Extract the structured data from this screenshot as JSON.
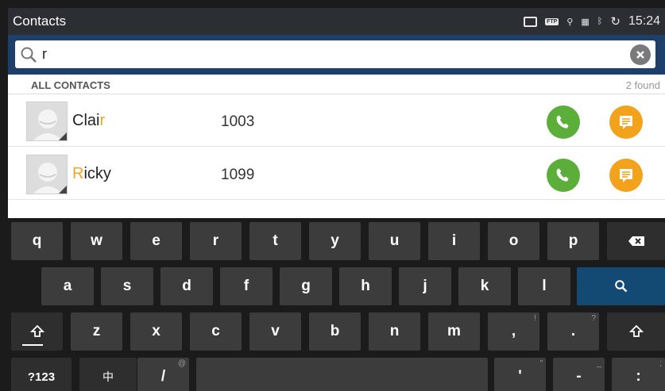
{
  "status_bar": {
    "title": "Contacts",
    "ftp_label": "FTP",
    "time": "15:24"
  },
  "search": {
    "query": "r",
    "placeholder": ""
  },
  "section": {
    "label": "ALL CONTACTS",
    "count": "2 found"
  },
  "contacts": [
    {
      "name_prefix": "Clai",
      "name_highlight": "r",
      "name_suffix": "",
      "number": "1003"
    },
    {
      "name_prefix": "",
      "name_highlight": "R",
      "name_suffix": "icky",
      "number": "1099"
    }
  ],
  "colors": {
    "accent_highlight": "#f0a51e",
    "call_green": "#5cae3a",
    "message_orange": "#f2a31b",
    "search_bar": "#1f3f6b",
    "search_key": "#134a73"
  },
  "keyboard": {
    "row1": [
      "q",
      "w",
      "e",
      "r",
      "t",
      "y",
      "u",
      "i",
      "o",
      "p"
    ],
    "row2": [
      "a",
      "s",
      "d",
      "f",
      "g",
      "h",
      "j",
      "k",
      "l"
    ],
    "row3": [
      "z",
      "x",
      "c",
      "v",
      "b",
      "n",
      "m",
      ",",
      "."
    ],
    "row3_subs": {
      "comma": "!",
      "period": "?"
    },
    "row4": {
      "symbols": "?123",
      "lang": "中",
      "slash": "/",
      "slash_sub": "@",
      "apostrophe": "'",
      "apostrophe_sub": "\"",
      "dash": "-",
      "dash_sub": "_",
      "colon": ":",
      "colon_sub": ";"
    }
  }
}
